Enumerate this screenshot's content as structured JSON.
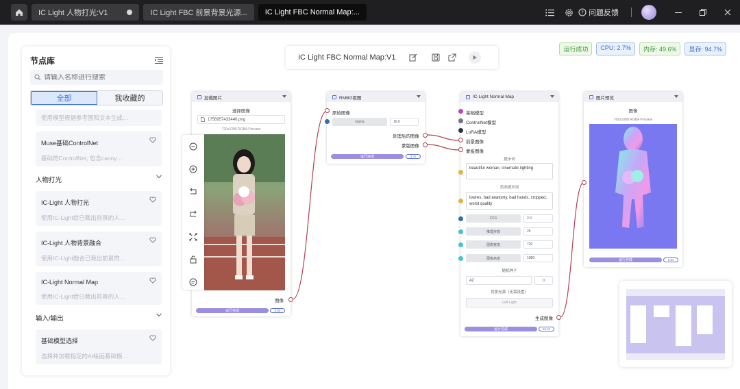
{
  "titlebar": {
    "tabs": [
      {
        "label": "IC Light 人物打光:V1",
        "active": false,
        "modified": true
      },
      {
        "label": "IC Light FBC 前景背景光源...",
        "active": false,
        "modified": false
      },
      {
        "label": "IC Light FBC Normal Map:...",
        "active": true,
        "modified": false
      }
    ],
    "feedback_label": "问题反馈"
  },
  "sidebar": {
    "title": "节点库",
    "search_placeholder": "请输入名称进行搜索",
    "tabs": [
      "全部",
      "我收藏的"
    ],
    "partial_card_desc": "使用模型根据参考图和文本生成…",
    "top_cards": [
      {
        "title": "Muse基础ControlNet",
        "desc": "基础的ControlNet, 包含canny…"
      }
    ],
    "sections": [
      {
        "title": "人物打光",
        "cards": [
          {
            "title": "IC-Light 人物打光",
            "desc": "使用IC-Light给已裁出前景的人…"
          },
          {
            "title": "IC-Light 人物背景融合",
            "desc": "使用IC-Light融合已裁出前景的…"
          },
          {
            "title": "IC-Light Normal Map",
            "desc": "使用IC-Light给已裁出前景的人…"
          }
        ]
      },
      {
        "title": "输入/输出",
        "cards": [
          {
            "title": "基础模型选择",
            "desc": "选择并加载指定的AI绘画基础模…"
          }
        ]
      }
    ]
  },
  "flowbar": {
    "name": "IC Light FBC Normal Map:V1"
  },
  "status": {
    "run_state": "运行成功",
    "cpu": "CPU: 2.7%",
    "memory": "内存: 49.6%",
    "vram": "显存: 94.7%"
  },
  "nodes": {
    "load_image": {
      "title": "加载图片",
      "select_label": "选择图像",
      "filename": "1756957433440.png",
      "preview_info": "720x1280 RGBA Preview",
      "output": "图像",
      "run_label": "运行完成",
      "pct": "0.3s"
    },
    "rmbg": {
      "title": "RMBG抠图",
      "input": "原始图像",
      "sigma_label": "sigma",
      "sigma_value": "16.0",
      "out1": "处理后的图像",
      "out2": "蒙版图像",
      "run_label": "运行完成",
      "pct": "3.7s"
    },
    "iclight": {
      "title": "IC-Light Normal Map",
      "inputs": [
        "基础模型",
        "ControlNet模型",
        "LoRA模型",
        "前景图像",
        "蒙板图像"
      ],
      "prompt_label": "提示词",
      "prompt": "beautiful woman, cinematic lighting",
      "neg_label": "负向提示词",
      "neg_prompt": "lowres, bad anatomy, bad hands, cropped, worst quality",
      "params": [
        {
          "label": "CFG",
          "value": "2.0"
        },
        {
          "label": "推理步数",
          "value": "25"
        },
        {
          "label": "图像宽度",
          "value": "720"
        },
        {
          "label": "图像高度",
          "value": "1080"
        }
      ],
      "seed_label": "随机种子",
      "seed_value": "42",
      "seed_mode": "0",
      "light_label": "背景光源（无需设置）",
      "light_value": "Left Light",
      "output": "生成图像",
      "run_label": "运行完成",
      "pct": "16.2s"
    },
    "preview": {
      "title": "图片预览",
      "label": "图像",
      "preview_info": "768x1088 RGBA Preview",
      "run_label": "运行完成",
      "pct": "0.0s"
    }
  },
  "colors": {
    "accent": "#3d73d8",
    "run_bar": "#9a8fe0",
    "port_magenta": "#c93fb5",
    "port_gray": "#6d7380",
    "port_dark": "#2c3340",
    "port_yellow": "#e0b53c",
    "port_blue": "#2f6fb0",
    "port_cyan": "#44c4cf",
    "link": "#b04050"
  }
}
